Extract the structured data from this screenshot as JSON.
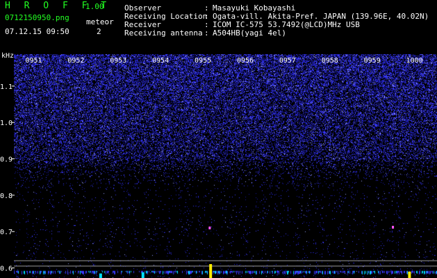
{
  "header": {
    "app_title": "H R O F F T",
    "app_version": "1.00",
    "file_name": "0712150950.png",
    "meteor_label": "meteor",
    "meteor_count": "2",
    "datetime": "07.12.15 09:50"
  },
  "info": [
    {
      "key": "Observer",
      "value": "Masayuki Kobayashi"
    },
    {
      "key": "Receiving Location",
      "value": "Ogata-vill. Akita-Pref. JAPAN (139.96E, 40.02N)"
    },
    {
      "key": "Receiver",
      "value": "ICOM IC-575 53.7492(@LCD)MHz USB"
    },
    {
      "key": "Receiving antenna",
      "value": "A504HB(yagi 4el)"
    }
  ],
  "colors": {
    "header_green": "#22ff22",
    "text_white": "#ffffff",
    "background": "#000000",
    "noise_blue": "#3a3aff",
    "noise_bright": "#9aa0ff",
    "signal_yellow": "#ffee00",
    "signal_cyan": "#00e0ff",
    "meteor_magenta": "#ff55ff",
    "line_gray": "#9a9a9a"
  },
  "chart_data": {
    "type": "heatmap",
    "ylabel": "kHz",
    "y_ticks": [
      "1.1",
      "1.0",
      "0.9",
      "0.8",
      "0.7",
      "0.6"
    ],
    "y_tick_values": [
      1.1,
      1.0,
      0.9,
      0.8,
      0.7,
      0.6
    ],
    "ylim": [
      0.58,
      1.18
    ],
    "x_labels": [
      "0951",
      "0952",
      "0953",
      "0954",
      "0955",
      "0956",
      "0957",
      "0958",
      "0959",
      "1000"
    ],
    "xlim_minutes": [
      0,
      10
    ],
    "noise_floor_khz": 0.9,
    "reference_lines_khz": [
      0.62,
      0.605
    ],
    "meteor_echoes": [
      {
        "time_minute": 4.62,
        "freq_khz": 0.71
      },
      {
        "time_minute": 8.95,
        "freq_khz": 0.712
      }
    ],
    "signal_spikes": [
      {
        "time_minute": 4.65,
        "freq_khz": 0.6,
        "color": "#ffee00",
        "strength": 1.0
      },
      {
        "time_minute": 3.05,
        "freq_khz": 0.6,
        "color": "#00e0ff",
        "strength": 0.35
      },
      {
        "time_minute": 2.05,
        "freq_khz": 0.6,
        "color": "#00e0ff",
        "strength": 0.25
      },
      {
        "time_minute": 9.35,
        "freq_khz": 0.6,
        "color": "#ffee00",
        "strength": 0.4
      }
    ]
  }
}
